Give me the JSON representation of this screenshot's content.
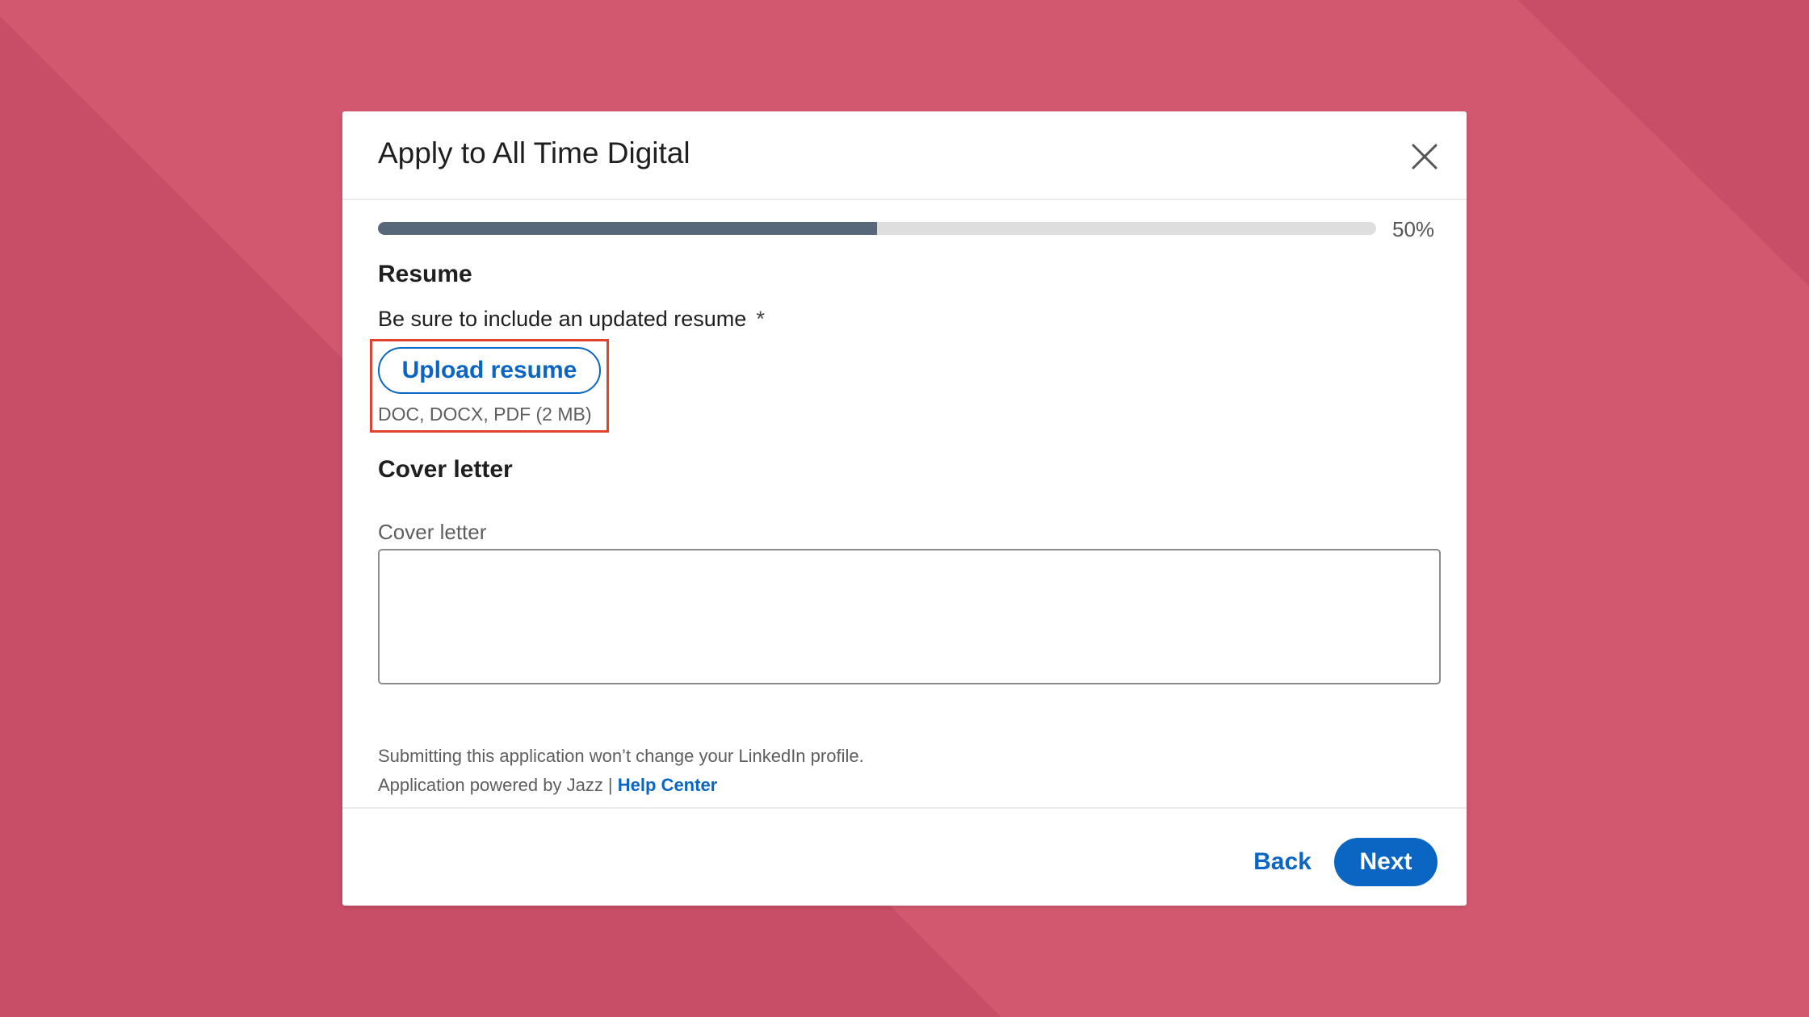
{
  "modal": {
    "title": "Apply to All Time Digital",
    "close_icon": "close-icon"
  },
  "progress": {
    "fraction": 0.5,
    "label": "50%"
  },
  "resume": {
    "heading": "Resume",
    "hint": "Be sure to include an updated resume",
    "required_mark": "*",
    "upload_label": "Upload resume",
    "file_types": "DOC, DOCX, PDF (2 MB)"
  },
  "cover_letter": {
    "heading": "Cover letter",
    "field_label": "Cover letter",
    "value": ""
  },
  "footer": {
    "note": "Submitting this application won’t change your LinkedIn profile.",
    "powered_by": "Application powered by Jazz | ",
    "help_link": "Help Center",
    "back_label": "Back",
    "next_label": "Next"
  },
  "colors": {
    "background": "#d25870",
    "accent": "#0a66c2",
    "progress_fill": "#56687a",
    "highlight_border": "#e0442e"
  }
}
